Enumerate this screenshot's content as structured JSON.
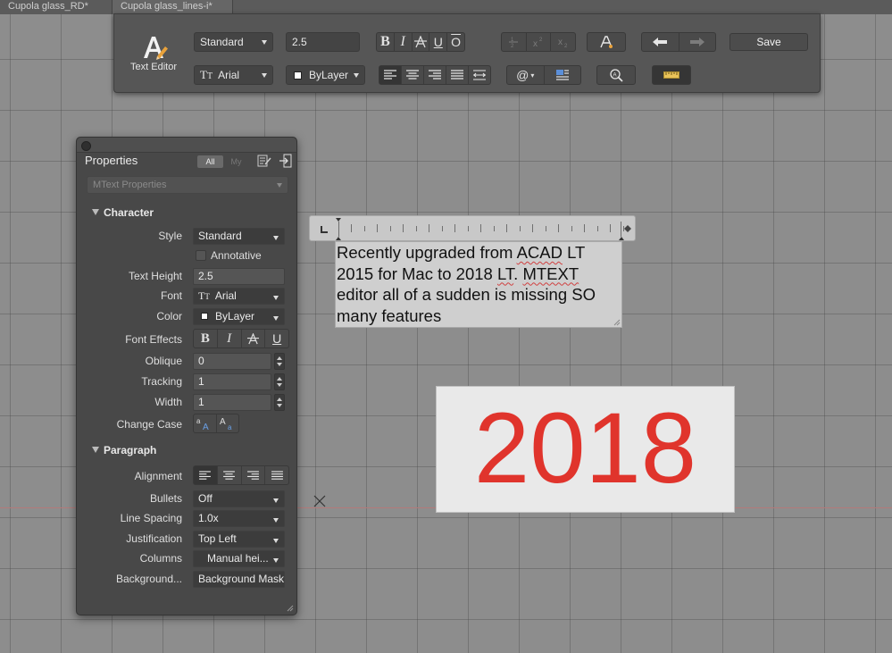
{
  "doc_tabs": [
    "Cupola glass_RD*",
    "Cupola glass_lines-i*"
  ],
  "toolbar": {
    "title": "Text Editor",
    "style_value": "Standard",
    "height_value": "2.5",
    "font_value": "Arial",
    "color_value": "ByLayer",
    "bold": "B",
    "italic": "I",
    "underline": "U",
    "overline": "O",
    "save_label": "Save"
  },
  "properties": {
    "title": "Properties",
    "filter_all": "All",
    "filter_my": "My",
    "object_type": "MText Properties",
    "character_section": "Character",
    "paragraph_section": "Paragraph",
    "style_label": "Style",
    "style_value": "Standard",
    "annotative_label": "Annotative",
    "text_height_label": "Text Height",
    "text_height_value": "2.5",
    "font_label": "Font",
    "font_value": "Arial",
    "color_label": "Color",
    "color_value": "ByLayer",
    "font_effects_label": "Font Effects",
    "oblique_label": "Oblique",
    "oblique_value": "0",
    "tracking_label": "Tracking",
    "tracking_value": "1",
    "width_label": "Width",
    "width_value": "1",
    "change_case_label": "Change Case",
    "alignment_label": "Alignment",
    "bullets_label": "Bullets",
    "bullets_value": "Off",
    "line_spacing_label": "Line Spacing",
    "line_spacing_value": "1.0x",
    "justification_label": "Justification",
    "justification_value": "Top Left",
    "columns_label": "Columns",
    "columns_value": "Manual hei...",
    "background_label": "Background...",
    "background_value": "Background Mask"
  },
  "mtext": {
    "line1_a": "Recently upgraded from ",
    "line1_b": "ACAD",
    "line1_c": " LT",
    "line2_a": "2015 for Mac to 2018 ",
    "line2_b": "LT",
    "line2_c": ". ",
    "line2_d": "MTEXT",
    "line3": "editor all of a sudden is missing SO",
    "line4": "many features"
  },
  "year_card": {
    "text": "2018",
    "color": "#e0342c"
  }
}
